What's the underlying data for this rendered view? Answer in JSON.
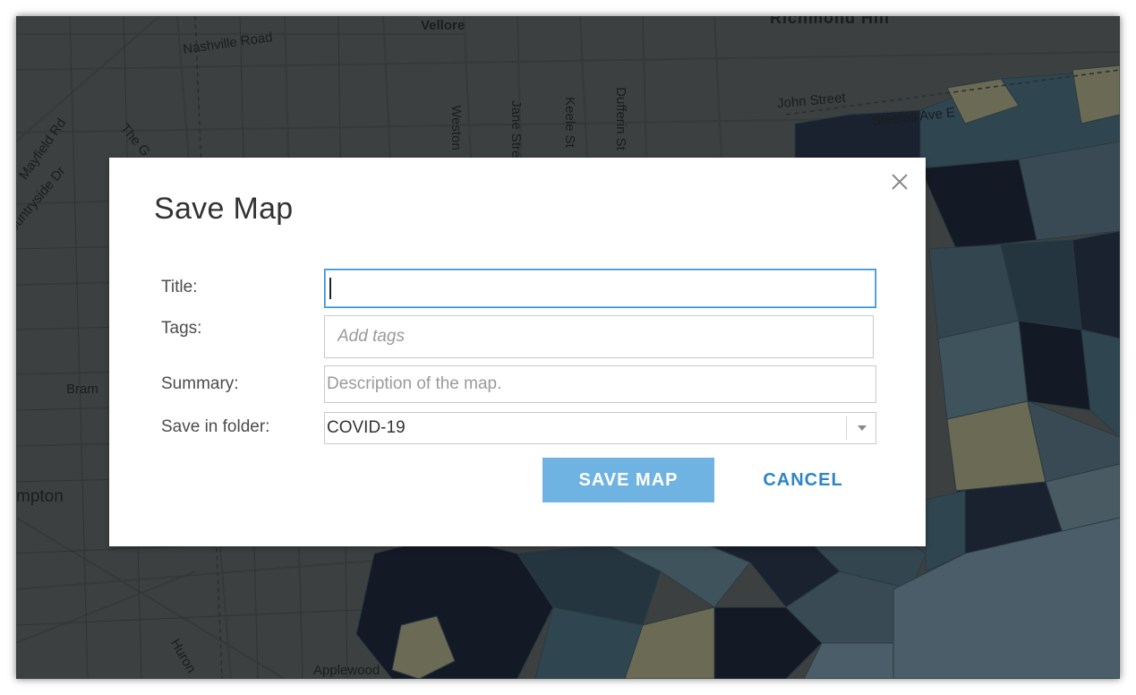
{
  "map": {
    "labels": {
      "nashville": "Nashville Road",
      "vellore": "Vellore",
      "richmond_hill": "Richmond Hill",
      "john_street": "John Street",
      "weston": "Weston",
      "jane_street": "Jane Street",
      "keele": "Keele St",
      "dufferin": "Dufferin St",
      "mayfield": "Mayfield Rd",
      "countryside": "Countryside Dr",
      "the_gore": "The G",
      "brampton_short": "Bram",
      "brampton_tail": "mpton",
      "huron": "Huron",
      "applewood": "Applewood",
      "steeles": "Steeles Ave E"
    }
  },
  "dialog": {
    "title": "Save Map",
    "close_icon": "close-icon",
    "fields": {
      "title_label": "Title:",
      "title_value": "",
      "tags_label": "Tags:",
      "tags_placeholder": "Add tags",
      "summary_label": "Summary:",
      "summary_placeholder": "Description of the map.",
      "folder_label": "Save in folder:",
      "folder_value": "COVID-19"
    },
    "buttons": {
      "save": "SAVE MAP",
      "cancel": "CANCEL"
    }
  },
  "colors": {
    "primary_button": "#6fb3e2",
    "link_blue": "#2d86c4",
    "focus_border": "#2f8fd1"
  }
}
